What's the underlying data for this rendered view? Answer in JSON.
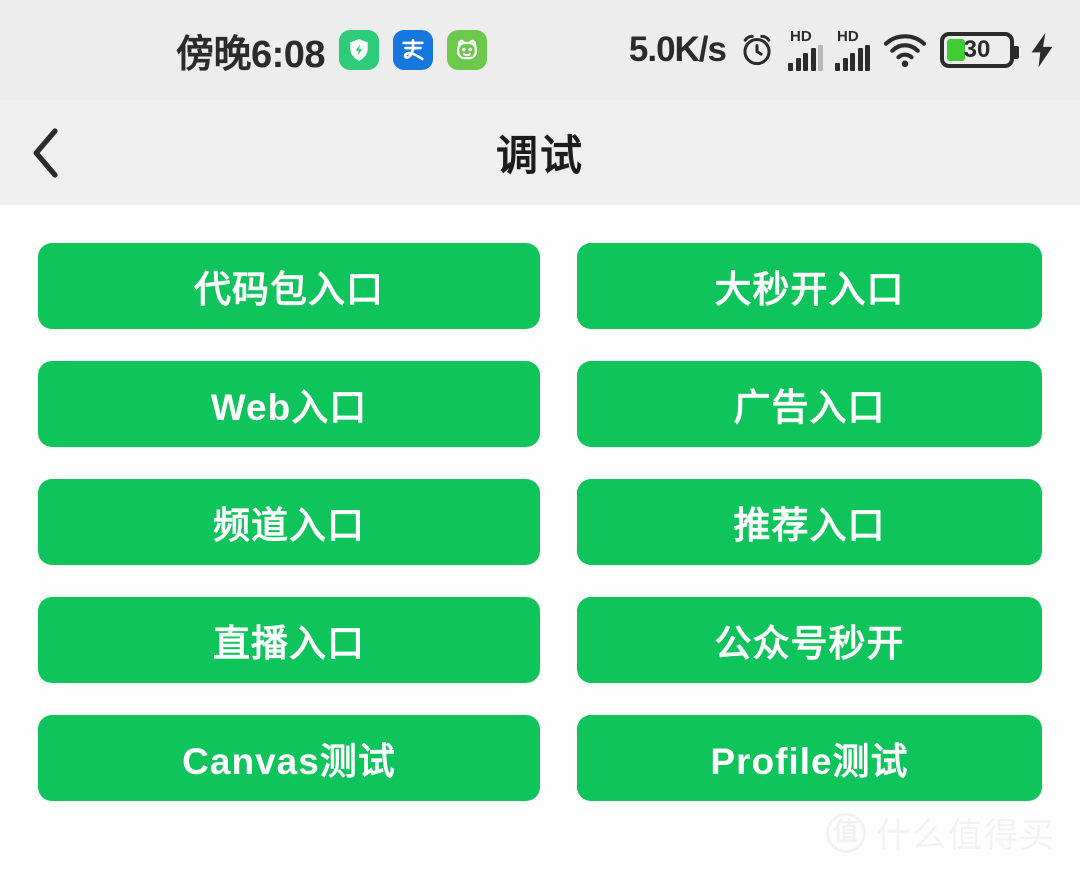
{
  "status_bar": {
    "time": "傍晚6:08",
    "network_speed": "5.0K/s",
    "notification_icons": [
      {
        "name": "security-shield-icon",
        "glyph": "shield-bolt",
        "color": "#2ecc78"
      },
      {
        "name": "alipay-icon",
        "glyph": "支",
        "color": "#1677de"
      },
      {
        "name": "panda-app-icon",
        "glyph": "panda-face",
        "color": "#6cc94b"
      }
    ],
    "alarm_icon": "alarm-clock-icon",
    "sim1": {
      "label": "HD",
      "bars": 4,
      "total": 5
    },
    "sim2": {
      "label": "HD",
      "bars": 5,
      "total": 5
    },
    "wifi_icon": "wifi-icon",
    "battery": {
      "level": "30",
      "percent": 30,
      "charging": true,
      "fill_color": "#3fcc34"
    }
  },
  "nav": {
    "back_icon": "chevron-left-icon",
    "title": "调试"
  },
  "theme": {
    "button_green": "#10c45c",
    "status_bar_bg": "#ededed",
    "nav_bar_bg": "#efefef",
    "page_bg": "#fdfefd",
    "button_text": "#ffffff"
  },
  "main": {
    "buttons": [
      {
        "label": "代码包入口",
        "name": "code-package-entry-button"
      },
      {
        "label": "大秒开入口",
        "name": "fast-open-entry-button"
      },
      {
        "label": "Web入口",
        "name": "web-entry-button"
      },
      {
        "label": "广告入口",
        "name": "ads-entry-button"
      },
      {
        "label": "频道入口",
        "name": "channel-entry-button"
      },
      {
        "label": "推荐入口",
        "name": "recommend-entry-button"
      },
      {
        "label": "直播入口",
        "name": "live-entry-button"
      },
      {
        "label": "公众号秒开",
        "name": "official-account-fast-open-button"
      },
      {
        "label": "Canvas测试",
        "name": "canvas-test-button"
      },
      {
        "label": "Profile测试",
        "name": "profile-test-button"
      }
    ]
  },
  "watermark": {
    "logo": "值",
    "text": "什么值得买"
  }
}
